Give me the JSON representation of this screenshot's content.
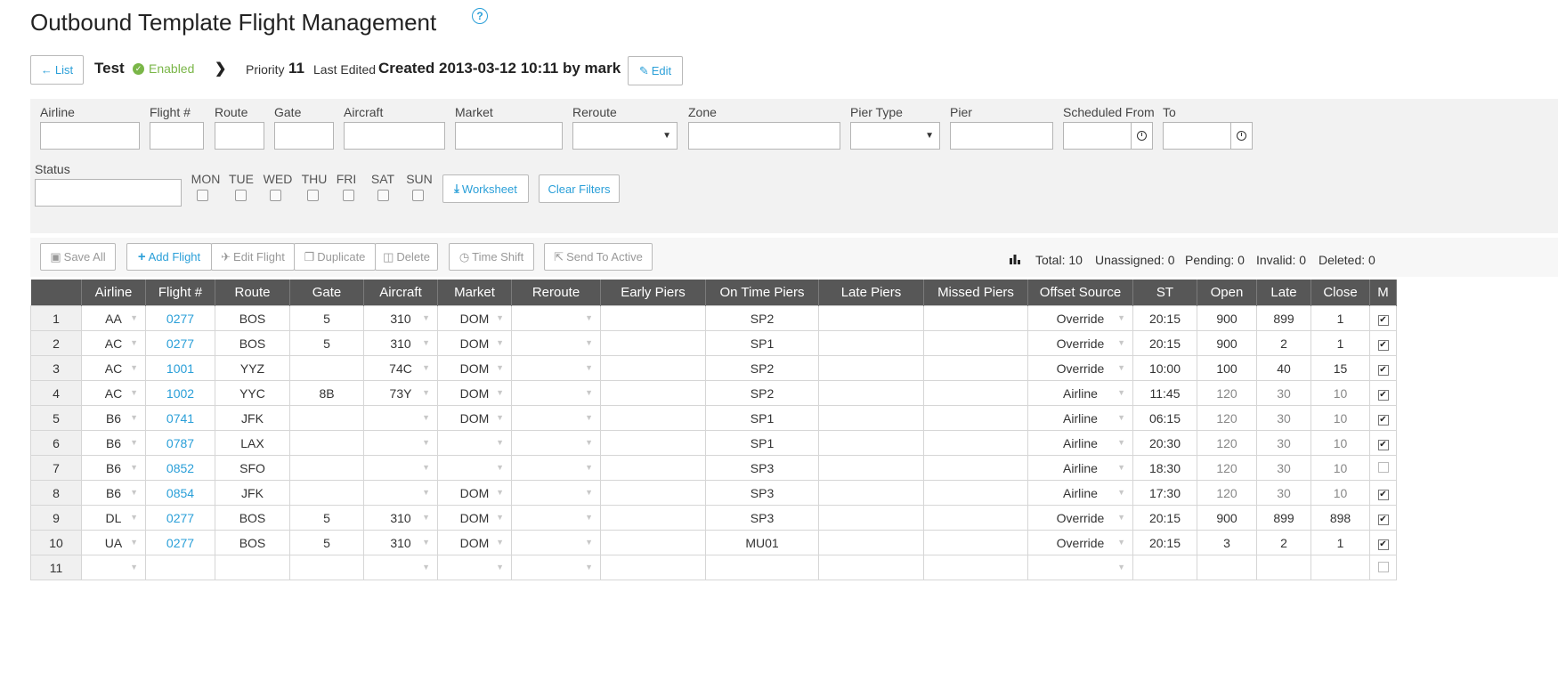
{
  "header": {
    "title": "Outbound Template Flight Management",
    "help_icon": "?",
    "list_label": "List",
    "template_name": "Test",
    "status": "Enabled",
    "priority_label": "Priority",
    "priority_value": "11",
    "last_edited_label": "Last Edited",
    "last_edited_value": "Created 2013-03-12 10:11 by mark",
    "edit_label": "Edit"
  },
  "filters": {
    "airline": "Airline",
    "flight": "Flight #",
    "route": "Route",
    "gate": "Gate",
    "aircraft": "Aircraft",
    "market": "Market",
    "reroute": "Reroute",
    "zone": "Zone",
    "pier_type": "Pier Type",
    "pier": "Pier",
    "scheduled_from": "Scheduled From",
    "to": "To",
    "status": "Status",
    "days": [
      "MON",
      "TUE",
      "WED",
      "THU",
      "FRI",
      "SAT",
      "SUN"
    ],
    "worksheet_label": "Worksheet",
    "clear_label": "Clear Filters"
  },
  "toolbar": {
    "save_all": "Save All",
    "add_flight": "Add Flight",
    "edit_flight": "Edit Flight",
    "duplicate": "Duplicate",
    "delete": "Delete",
    "time_shift": "Time Shift",
    "send_to_active": "Send To Active"
  },
  "stats": {
    "total": "Total: 10",
    "unassigned": "Unassigned: 0",
    "pending": "Pending: 0",
    "invalid": "Invalid: 0",
    "deleted": "Deleted: 0"
  },
  "table": {
    "columns": [
      "",
      "Airline",
      "Flight #",
      "Route",
      "Gate",
      "Aircraft",
      "Market",
      "Reroute",
      "Early Piers",
      "On Time Piers",
      "Late Piers",
      "Missed Piers",
      "Offset Source",
      "ST",
      "Open",
      "Late",
      "Close",
      "M"
    ],
    "rows": [
      {
        "n": "1",
        "airline": "AA",
        "flight": "0277",
        "route": "BOS",
        "gate": "5",
        "aircraft": "310",
        "market": "DOM",
        "reroute": "",
        "early": "",
        "ontime": "SP2",
        "late": "",
        "missed": "",
        "offset": "Override",
        "st": "20:15",
        "open": "900",
        "latev": "899",
        "close": "1",
        "m": true
      },
      {
        "n": "2",
        "airline": "AC",
        "flight": "0277",
        "route": "BOS",
        "gate": "5",
        "aircraft": "310",
        "market": "DOM",
        "reroute": "",
        "early": "",
        "ontime": "SP1",
        "late": "",
        "missed": "",
        "offset": "Override",
        "st": "20:15",
        "open": "900",
        "latev": "2",
        "close": "1",
        "m": true
      },
      {
        "n": "3",
        "airline": "AC",
        "flight": "1001",
        "route": "YYZ",
        "gate": "",
        "aircraft": "74C",
        "market": "DOM",
        "reroute": "",
        "early": "",
        "ontime": "SP2",
        "late": "",
        "missed": "",
        "offset": "Override",
        "st": "10:00",
        "open": "100",
        "latev": "40",
        "close": "15",
        "m": true
      },
      {
        "n": "4",
        "airline": "AC",
        "flight": "1002",
        "route": "YYC",
        "gate": "8B",
        "aircraft": "73Y",
        "market": "DOM",
        "reroute": "",
        "early": "",
        "ontime": "SP2",
        "late": "",
        "missed": "",
        "offset": "Airline",
        "st": "11:45",
        "open": "120",
        "latev": "30",
        "close": "10",
        "m": true
      },
      {
        "n": "5",
        "airline": "B6",
        "flight": "0741",
        "route": "JFK",
        "gate": "",
        "aircraft": "",
        "market": "DOM",
        "reroute": "",
        "early": "",
        "ontime": "SP1",
        "late": "",
        "missed": "",
        "offset": "Airline",
        "st": "06:15",
        "open": "120",
        "latev": "30",
        "close": "10",
        "m": true
      },
      {
        "n": "6",
        "airline": "B6",
        "flight": "0787",
        "route": "LAX",
        "gate": "",
        "aircraft": "",
        "market": "",
        "reroute": "",
        "early": "",
        "ontime": "SP1",
        "late": "",
        "missed": "",
        "offset": "Airline",
        "st": "20:30",
        "open": "120",
        "latev": "30",
        "close": "10",
        "m": true
      },
      {
        "n": "7",
        "airline": "B6",
        "flight": "0852",
        "route": "SFO",
        "gate": "",
        "aircraft": "",
        "market": "",
        "reroute": "",
        "early": "",
        "ontime": "SP3",
        "late": "",
        "missed": "",
        "offset": "Airline",
        "st": "18:30",
        "open": "120",
        "latev": "30",
        "close": "10",
        "m": false
      },
      {
        "n": "8",
        "airline": "B6",
        "flight": "0854",
        "route": "JFK",
        "gate": "",
        "aircraft": "",
        "market": "DOM",
        "reroute": "",
        "early": "",
        "ontime": "SP3",
        "late": "",
        "missed": "",
        "offset": "Airline",
        "st": "17:30",
        "open": "120",
        "latev": "30",
        "close": "10",
        "m": true
      },
      {
        "n": "9",
        "airline": "DL",
        "flight": "0277",
        "route": "BOS",
        "gate": "5",
        "aircraft": "310",
        "market": "DOM",
        "reroute": "",
        "early": "",
        "ontime": "SP3",
        "late": "",
        "missed": "",
        "offset": "Override",
        "st": "20:15",
        "open": "900",
        "latev": "899",
        "close": "898",
        "m": true
      },
      {
        "n": "10",
        "airline": "UA",
        "flight": "0277",
        "route": "BOS",
        "gate": "5",
        "aircraft": "310",
        "market": "DOM",
        "reroute": "",
        "early": "",
        "ontime": "MU01",
        "late": "",
        "missed": "",
        "offset": "Override",
        "st": "20:15",
        "open": "3",
        "latev": "2",
        "close": "1",
        "m": true
      },
      {
        "n": "11",
        "airline": "",
        "flight": "",
        "route": "",
        "gate": "",
        "aircraft": "",
        "market": "",
        "reroute": "",
        "early": "",
        "ontime": "",
        "late": "",
        "missed": "",
        "offset": "",
        "st": "",
        "open": "",
        "latev": "",
        "close": "",
        "m": false
      }
    ]
  },
  "colors": {
    "accent": "#2a9fd8",
    "enabled": "#7ab648",
    "header_bg": "#575757"
  }
}
